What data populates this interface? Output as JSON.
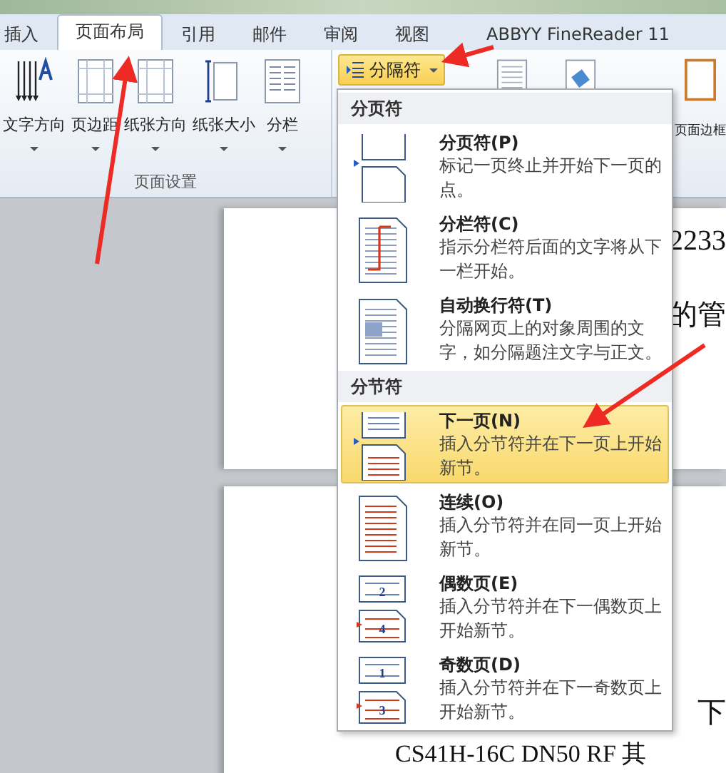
{
  "tabs": [
    {
      "label": "插入",
      "selected": false
    },
    {
      "label": "页面布局",
      "selected": true
    },
    {
      "label": "引用",
      "selected": false
    },
    {
      "label": "邮件",
      "selected": false
    },
    {
      "label": "审阅",
      "selected": false
    },
    {
      "label": "视图",
      "selected": false
    },
    {
      "label": "ABBYY FineReader 11",
      "selected": false
    }
  ],
  "ribbon": {
    "group_label": "页面设置",
    "buttons": [
      {
        "label": "文字方向",
        "kind": "direction"
      },
      {
        "label": "页边距",
        "kind": "margins"
      },
      {
        "label": "纸张方向",
        "kind": "orientation"
      },
      {
        "label": "纸张大小",
        "kind": "size"
      },
      {
        "label": "分栏",
        "kind": "columns"
      }
    ],
    "breaks_button": {
      "label": "分隔符",
      "active": true
    },
    "right_buttons": [
      {
        "kind": "watermark"
      },
      {
        "kind": "color"
      },
      {
        "label": "页面边框",
        "kind": "border"
      }
    ]
  },
  "document": {
    "page_1_lines": [
      "2233",
      "的管"
    ],
    "page_2_lines": [
      "下",
      "CS41H-16C DN50 RF 其"
    ]
  },
  "menu": {
    "sections": [
      {
        "title": "分页符",
        "items": [
          {
            "kind": "page",
            "title": "分页符(P)",
            "description": "标记一页终止并开始下一页的点。",
            "selected": false
          },
          {
            "kind": "column",
            "title": "分栏符(C)",
            "description": "指示分栏符后面的文字将从下一栏开始。",
            "selected": false
          },
          {
            "kind": "wrap",
            "title": "自动换行符(T)",
            "description": "分隔网页上的对象周围的文字，如分隔题注文字与正文。",
            "selected": false
          }
        ]
      },
      {
        "title": "分节符",
        "items": [
          {
            "kind": "next",
            "title": "下一页(N)",
            "description": "插入分节符并在下一页上开始新节。",
            "selected": true
          },
          {
            "kind": "continuous",
            "title": "连续(O)",
            "description": "插入分节符并在同一页上开始新节。",
            "selected": false
          },
          {
            "kind": "even",
            "page_numbers": [
              "2",
              "4"
            ],
            "title": "偶数页(E)",
            "description": "插入分节符并在下一偶数页上开始新节。",
            "selected": false
          },
          {
            "kind": "odd",
            "page_numbers": [
              "1",
              "3"
            ],
            "title": "奇数页(D)",
            "description": "插入分节符并在下一奇数页上开始新节。",
            "selected": false
          }
        ]
      }
    ]
  }
}
